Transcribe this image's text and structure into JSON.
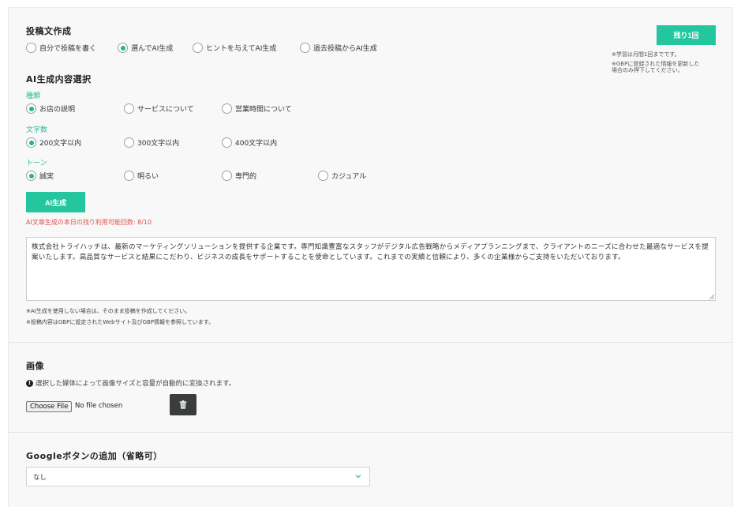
{
  "post_creation": {
    "title": "投稿文作成",
    "modes": [
      {
        "label": "自分で投稿を書く",
        "selected": false
      },
      {
        "label": "選んでAI生成",
        "selected": true
      },
      {
        "label": "ヒントを与えてAI生成",
        "selected": false
      },
      {
        "label": "過去投稿からAI生成",
        "selected": false
      }
    ],
    "remaining_button": "残り1回",
    "notes": [
      "※学習は月間1回までです。",
      "※GBPに登録された情報を更新した",
      "場合のみ押下してください。"
    ]
  },
  "ai_selection": {
    "title": "AI生成内容選択",
    "kind": {
      "label": "種類",
      "options": [
        {
          "label": "お店の説明",
          "selected": true
        },
        {
          "label": "サービスについて",
          "selected": false
        },
        {
          "label": "営業時間について",
          "selected": false
        }
      ]
    },
    "length": {
      "label": "文字数",
      "options": [
        {
          "label": "200文字以内",
          "selected": true
        },
        {
          "label": "300文字以内",
          "selected": false
        },
        {
          "label": "400文字以内",
          "selected": false
        }
      ]
    },
    "tone": {
      "label": "トーン",
      "options": [
        {
          "label": "誠実",
          "selected": true
        },
        {
          "label": "明るい",
          "selected": false
        },
        {
          "label": "専門的",
          "selected": false
        },
        {
          "label": "カジュアル",
          "selected": false
        }
      ]
    },
    "generate_button": "AI生成",
    "usage_note": "AI文章生成の本日の残り利用可能回数: 8/10"
  },
  "post_text": "株式会社トライハッチは、最新のマーケティングソリューションを提供する企業です。専門知識豊富なスタッフがデジタル広告戦略からメディアプランニングまで、クライアントのニーズに合わせた最適なサービスを提案いたします。高品質なサービスと結果にこだわり、ビジネスの成長をサポートすることを使命としています。これまでの実績と信頼により、多くの企業様からご支持をいただいております。",
  "post_notes": [
    "※AI生成を使用しない場合は、そのまま投稿を作成してください。",
    "※投稿内容はGBPに設定されたWebサイト及びGBP情報を参照しています。"
  ],
  "image": {
    "title": "画像",
    "info": "選択した媒体によって画像サイズと容量が自動的に変換されます。",
    "choose_file": "Choose File",
    "no_file": "No file chosen"
  },
  "google_button": {
    "title": "Googleボタンの追加（省略可）",
    "selected": "なし"
  },
  "colors": {
    "accent": "#24c79d",
    "label": "#2db89a",
    "warning": "#e0524f"
  }
}
